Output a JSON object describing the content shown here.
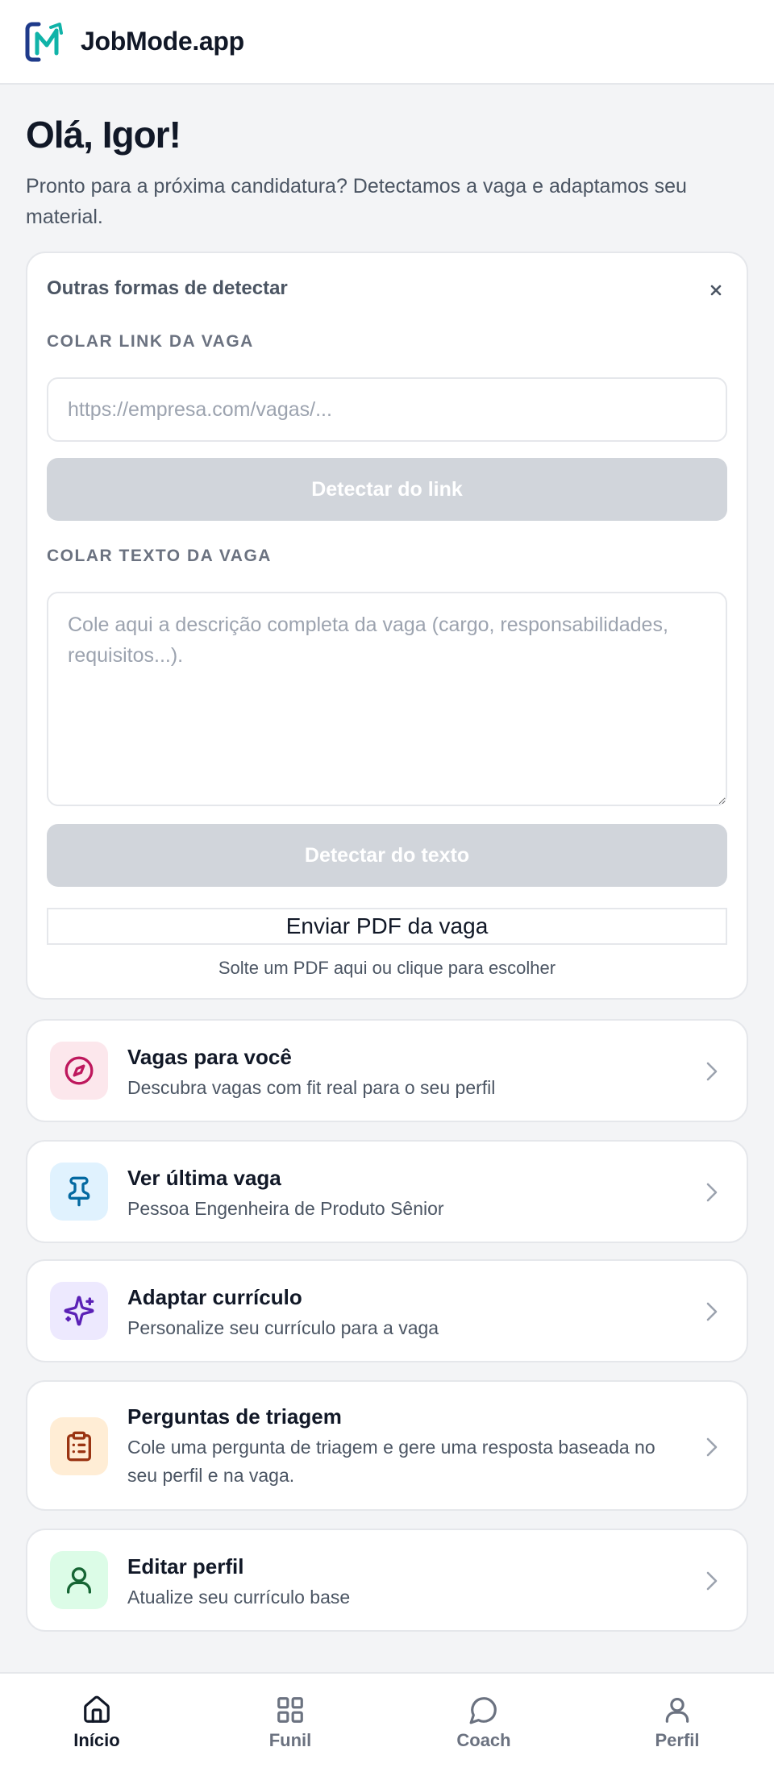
{
  "header": {
    "brand": "JobMode.app",
    "logo_icon": "jobmode-logo"
  },
  "greeting": "Olá, Igor!",
  "subtitle": "Pronto para a próxima candidatura? Detectamos a vaga e adaptamos seu material.",
  "detect": {
    "title": "Outras formas de detectar",
    "close_icon": "close-icon",
    "link_label": "COLAR LINK DA VAGA",
    "link_placeholder": "https://empresa.com/vagas/...",
    "link_value": "",
    "link_button": "Detectar do link",
    "text_label": "COLAR TEXTO DA VAGA",
    "text_placeholder": "Cole aqui a descrição completa da vaga (cargo, responsabilidades, requisitos...).",
    "text_value": "",
    "text_button": "Detectar do texto",
    "pdf_button": "Enviar PDF da vaga",
    "pdf_hint": "Solte um PDF aqui ou clique para escolher"
  },
  "actions": [
    {
      "title": "Vagas para você",
      "desc": "Descubra vagas com fit real para o seu perfil",
      "icon": "compass-icon",
      "icon_bg": "#fce7ec",
      "icon_color": "#be185d"
    },
    {
      "title": "Ver última vaga",
      "desc": "Pessoa Engenheira de Produto Sênior",
      "icon": "pin-icon",
      "icon_bg": "#e0f2fe",
      "icon_color": "#0369a1"
    },
    {
      "title": "Adaptar currículo",
      "desc": "Personalize seu currículo para a vaga",
      "icon": "sparkles-icon",
      "icon_bg": "#ede9fe",
      "icon_color": "#5b21b6"
    },
    {
      "title": "Perguntas de triagem",
      "desc": "Cole uma pergunta de triagem e gere uma resposta baseada no seu perfil e na vaga.",
      "icon": "clipboard-icon",
      "icon_bg": "#ffedd5",
      "icon_color": "#9a3412"
    },
    {
      "title": "Editar perfil",
      "desc": "Atualize seu currículo base",
      "icon": "user-icon",
      "icon_bg": "#dcfce7",
      "icon_color": "#166534"
    }
  ],
  "nav": [
    {
      "label": "Início",
      "icon": "home-icon",
      "active": true
    },
    {
      "label": "Funil",
      "icon": "grid-icon",
      "active": false
    },
    {
      "label": "Coach",
      "icon": "chat-icon",
      "active": false
    },
    {
      "label": "Perfil",
      "icon": "user-icon",
      "active": false
    }
  ],
  "colors": {
    "accent_teal": "#10b3a8",
    "brand_navy": "#1e3a8a",
    "disabled_button": "#d1d5db",
    "background": "#f3f4f6"
  }
}
